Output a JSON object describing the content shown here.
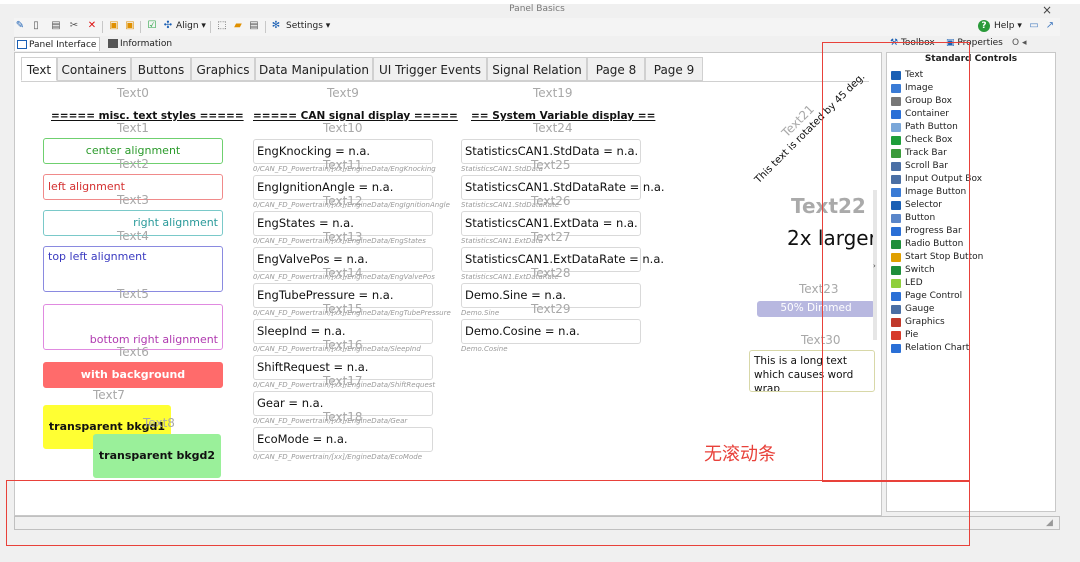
{
  "window": {
    "title": "Panel Basics",
    "close": "×"
  },
  "toolbar": {
    "align_label": "Align ▾",
    "settings_label": "Settings ▾",
    "help_label": "Help ▾"
  },
  "view_tabs": [
    {
      "label": "Panel Interface"
    },
    {
      "label": "Information"
    }
  ],
  "panel_tabs": [
    "Text",
    "Containers",
    "Buttons",
    "Graphics",
    "Data Manipulation",
    "UI Trigger Events",
    "Signal Relation",
    "Page 8",
    "Page 9"
  ],
  "col1": {
    "t0": "Text0",
    "header": "===== misc. text styles =====",
    "t1": "Text1",
    "b_center": "center alignment",
    "t2": "Text2",
    "b_left": "left alignment",
    "t3": "Text3",
    "b_right": "right alignment",
    "t4": "Text4",
    "b_top": "top left alignment",
    "t5": "Text5",
    "b_bottom": "bottom right alignment",
    "t6": "Text6",
    "b_bg": "with background",
    "t7": "Text7",
    "b_trans1": "transparent bkgd1",
    "t8": "Text8",
    "b_trans2": "transparent bkgd2"
  },
  "col2": {
    "t9": "Text9",
    "header": "===== CAN signal display =====",
    "t10": "Text10",
    "rows": [
      {
        "value": "EngKnocking = n.a.",
        "path": "0/CAN_FD_Powertrain/[xx]/EngineData/EngKnocking",
        "label": "Text11"
      },
      {
        "value": "EngIgnitionAngle = n.a.",
        "path": "0/CAN_FD_Powertrain/[xx]/EngineData/EngIgnitionAngle",
        "label": "Text12"
      },
      {
        "value": "EngStates = n.a.",
        "path": "0/CAN_FD_Powertrain/[xx]/EngineData/EngStates",
        "label": "Text13"
      },
      {
        "value": "EngValvePos = n.a.",
        "path": "0/CAN_FD_Powertrain/[xx]/EngineData/EngValvePos",
        "label": "Text14"
      },
      {
        "value": "EngTubePressure = n.a.",
        "path": "0/CAN_FD_Powertrain/[xx]/EngineData/EngTubePressure",
        "label": "Text15"
      },
      {
        "value": "SleepInd = n.a.",
        "path": "0/CAN_FD_Powertrain/[xx]/EngineData/SleepInd",
        "label": "Text16"
      },
      {
        "value": "ShiftRequest = n.a.",
        "path": "0/CAN_FD_Powertrain/[xx]/EngineData/ShiftRequest",
        "label": "Text17"
      },
      {
        "value": "Gear = n.a.",
        "path": "0/CAN_FD_Powertrain/[xx]/EngineData/Gear",
        "label": "Text18"
      },
      {
        "value": "EcoMode = n.a.",
        "path": "0/CAN_FD_Powertrain/[xx]/EngineData/EcoMode",
        "label": ""
      }
    ]
  },
  "col3": {
    "t19": "Text19",
    "header": "== System Variable display ==",
    "t24": "Text24",
    "rows": [
      {
        "value": "StatisticsCAN1.StdData = n.a.",
        "path": "StatisticsCAN1.StdData",
        "label": "Text25"
      },
      {
        "value": "StatisticsCAN1.StdDataRate = n.a.",
        "path": "StatisticsCAN1.StdDataRate",
        "label": "Text26"
      },
      {
        "value": "StatisticsCAN1.ExtData = n.a.",
        "path": "StatisticsCAN1.ExtData",
        "label": "Text27"
      },
      {
        "value": "StatisticsCAN1.ExtDataRate = n.a.",
        "path": "StatisticsCAN1.ExtDataRate",
        "label": "Text28"
      },
      {
        "value": "Demo.Sine = n.a.",
        "path": "Demo.Sine",
        "label": "Text29"
      },
      {
        "value": "Demo.Cosine = n.a.",
        "path": "Demo.Cosine",
        "label": ""
      }
    ]
  },
  "col4": {
    "t21": "Text21",
    "rotated": "This text is rotated by 45 deg.",
    "t22": "Text22",
    "larger": "2x larger",
    "t23": "Text23",
    "dimmed": "50% Dimmed",
    "t30": "Text30",
    "wrap": "This is a long text which causes word wrap"
  },
  "right_pane": {
    "tabs": {
      "toolbox": "Toolbox",
      "properties": "Properties",
      "extra": "O ◂"
    },
    "heading": "Standard Controls",
    "items": [
      {
        "label": "Text",
        "icon": "text-icon",
        "color": "#1a5fb4"
      },
      {
        "label": "Image",
        "icon": "image-icon",
        "color": "#3a7bd5"
      },
      {
        "label": "Group Box",
        "icon": "groupbox-icon",
        "color": "#777777"
      },
      {
        "label": "Container",
        "icon": "container-icon",
        "color": "#2a6fd6"
      },
      {
        "label": "Path Button",
        "icon": "path-button-icon",
        "color": "#7aa7d9"
      },
      {
        "label": "Check Box",
        "icon": "checkbox-icon",
        "color": "#1e9e3a"
      },
      {
        "label": "Track Bar",
        "icon": "trackbar-icon",
        "color": "#3a9a3a"
      },
      {
        "label": "Scroll Bar",
        "icon": "scrollbar-icon",
        "color": "#4a6fa5"
      },
      {
        "label": "Input Output Box",
        "icon": "io-box-icon",
        "color": "#4a6fa5"
      },
      {
        "label": "Image Button",
        "icon": "image-button-icon",
        "color": "#3a7bd5"
      },
      {
        "label": "Selector",
        "icon": "selector-icon",
        "color": "#1a5fb4"
      },
      {
        "label": "Button",
        "icon": "button-icon",
        "color": "#5a86c9"
      },
      {
        "label": "Progress Bar",
        "icon": "progressbar-icon",
        "color": "#2a6fd6"
      },
      {
        "label": "Radio Button",
        "icon": "radio-icon",
        "color": "#1e8e3a"
      },
      {
        "label": "Start Stop Button",
        "icon": "start-stop-icon",
        "color": "#e0a000"
      },
      {
        "label": "Switch",
        "icon": "switch-icon",
        "color": "#1e8e3a"
      },
      {
        "label": "LED",
        "icon": "led-icon",
        "color": "#8fcf3a"
      },
      {
        "label": "Page Control",
        "icon": "page-control-icon",
        "color": "#2a6fd6"
      },
      {
        "label": "Gauge",
        "icon": "gauge-icon",
        "color": "#4a6fa5"
      },
      {
        "label": "Graphics",
        "icon": "graphics-icon",
        "color": "#c0392b"
      },
      {
        "label": "Pie",
        "icon": "pie-icon",
        "color": "#d63a2a"
      },
      {
        "label": "Relation Chart",
        "icon": "relation-chart-icon",
        "color": "#2a6fd6"
      }
    ]
  },
  "annotation": {
    "text": "无滚动条",
    "color": "#e8413a"
  }
}
